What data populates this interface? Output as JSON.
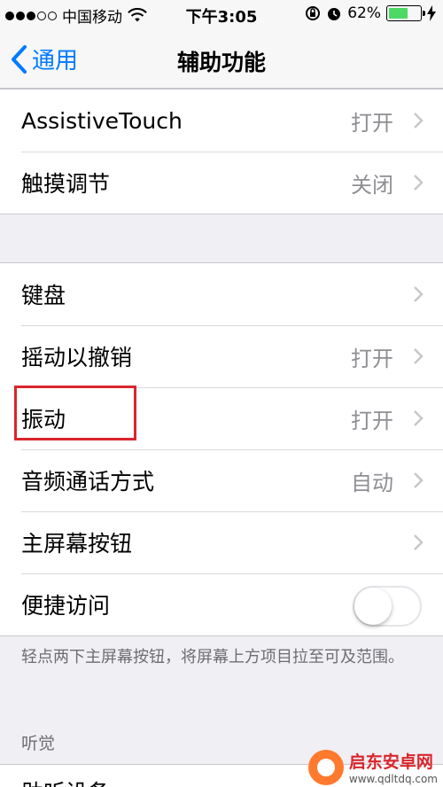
{
  "status_bar": {
    "carrier": "中国移动",
    "time": "下午3:05",
    "battery_percent": "62%",
    "battery_level": 0.62,
    "signal_bars_filled": 3,
    "signal_bars_total": 5,
    "icons": [
      "wifi-icon",
      "rotation-lock-icon",
      "alarm-icon",
      "battery-icon",
      "charging-icon"
    ]
  },
  "nav": {
    "back_label": "通用",
    "title": "辅助功能"
  },
  "group1": [
    {
      "label": "AssistiveTouch",
      "value": "打开"
    },
    {
      "label": "触摸调节",
      "value": "关闭"
    }
  ],
  "group2": [
    {
      "label": "键盘",
      "value": ""
    },
    {
      "label": "摇动以撤销",
      "value": "打开"
    },
    {
      "label": "振动",
      "value": "打开"
    },
    {
      "label": "音频通话方式",
      "value": "自动"
    },
    {
      "label": "主屏幕按钮",
      "value": ""
    },
    {
      "label": "便捷访问",
      "toggle": false
    }
  ],
  "footer_note": "轻点两下主屏幕按钮，将屏幕上方项目拉至可及范围。",
  "section_header": "听觉",
  "next_row_label": "助听设备",
  "watermark": {
    "name": "启东安卓网",
    "url": "www.qdltdq.com"
  },
  "colors": {
    "accent": "#007aff",
    "battery": "#4cd964",
    "highlight": "#d9262c",
    "background": "#efeff4"
  }
}
